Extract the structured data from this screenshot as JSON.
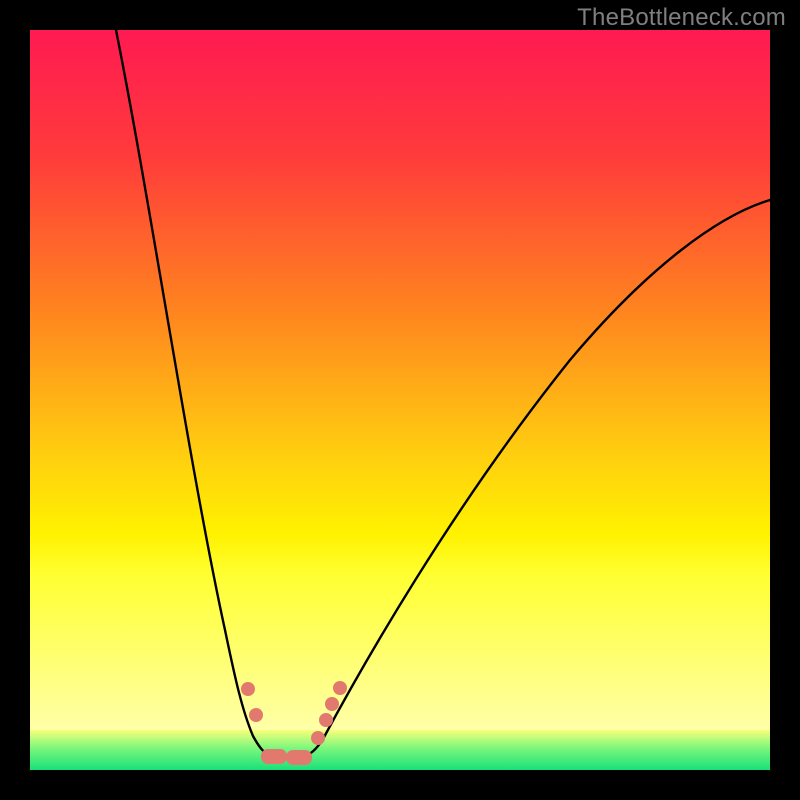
{
  "watermark": "TheBottleneck.com",
  "colors": {
    "background": "#000000",
    "gradient_top": "#ff1a52",
    "gradient_mid": "#ffcc10",
    "gradient_low": "#ffffa8",
    "green_band_top": "#f7ff7a",
    "green_band_bottom": "#19e07a",
    "curve": "#000000",
    "marker": "#e2796e",
    "watermark": "#7f7f7f"
  },
  "chart_data": {
    "type": "line",
    "title": "",
    "xlabel": "",
    "ylabel": "",
    "xlim": [
      0,
      100
    ],
    "ylim": [
      0,
      100
    ],
    "x": [
      12,
      14,
      16,
      18,
      20,
      22,
      24,
      26,
      28,
      30,
      32,
      33,
      34,
      35,
      36,
      38,
      39,
      40,
      41,
      43,
      47,
      55,
      65,
      75,
      85,
      95,
      100
    ],
    "values": [
      100,
      90,
      80,
      70,
      58,
      48,
      38,
      30,
      22,
      14,
      7,
      5,
      3,
      2,
      2,
      2,
      3,
      5,
      7,
      12,
      22,
      38,
      55,
      66,
      73,
      77,
      78
    ],
    "note": "x and y are approximate percentages of the plot width/height; y=0 is the green band at the bottom (optimal), y=100 is the red top",
    "markers": {
      "x": [
        30,
        31,
        33,
        35,
        39,
        40,
        41,
        42
      ],
      "y": [
        11,
        7,
        2,
        2,
        4,
        7,
        9,
        11
      ]
    },
    "annotations": []
  }
}
